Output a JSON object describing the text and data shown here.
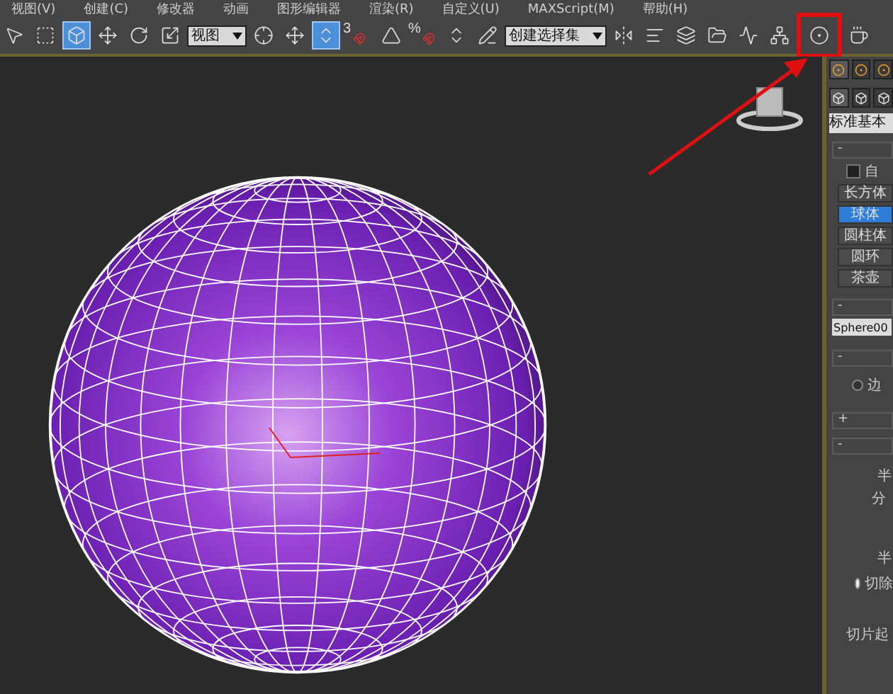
{
  "menu": [
    "视图(V)",
    "创建(C)",
    "修改器",
    "动画",
    "图形编辑器",
    "渲染(R)",
    "自定义(U)",
    "MAXScript(M)",
    "帮助(H)"
  ],
  "toolbar": [
    {
      "kind": "tool",
      "selected": false
    },
    {
      "kind": "tool",
      "selected": false
    },
    {
      "kind": "tool",
      "selected": true
    },
    {
      "kind": "tool",
      "selected": false
    },
    {
      "kind": "tool",
      "selected": false
    },
    {
      "kind": "tool",
      "selected": false
    },
    {
      "kind": "dropdown",
      "value": "视图"
    },
    {
      "kind": "tool",
      "selected": false
    },
    {
      "kind": "tool",
      "selected": false
    },
    {
      "kind": "tool",
      "selected": true
    },
    {
      "kind": "snap",
      "label": "3"
    },
    {
      "kind": "tool",
      "selected": false
    },
    {
      "kind": "snap",
      "label": "%"
    },
    {
      "kind": "tool",
      "selected": false
    },
    {
      "kind": "tool",
      "selected": false
    },
    {
      "kind": "dropdown",
      "value": "创建选择集"
    },
    {
      "kind": "tool",
      "selected": false
    },
    {
      "kind": "tool",
      "selected": false
    },
    {
      "kind": "tool",
      "selected": false
    },
    {
      "kind": "tool",
      "selected": false
    },
    {
      "kind": "tool",
      "selected": false
    },
    {
      "kind": "tool",
      "selected": false
    },
    {
      "kind": "tool",
      "selected": false,
      "highlighted": true
    },
    {
      "kind": "tool",
      "selected": false
    }
  ],
  "panel": {
    "tabs": [
      {
        "selected": true
      },
      {
        "selected": false
      },
      {
        "selected": false
      }
    ],
    "categories": [
      {
        "selected": true
      },
      {
        "selected": false
      },
      {
        "selected": false
      }
    ],
    "dropdown": "标准基本",
    "autogrid": {
      "label": "自",
      "checked": false
    },
    "object_types": [
      {
        "label": "长方体",
        "selected": false
      },
      {
        "label": "球体",
        "selected": true
      },
      {
        "label": "圆柱体",
        "selected": false
      },
      {
        "label": "圆环",
        "selected": false
      },
      {
        "label": "茶壶",
        "selected": false
      }
    ],
    "name_field": "Sphere00",
    "sections": [
      "-",
      "-",
      "-",
      "+",
      "-"
    ],
    "method_radio": {
      "label": "边",
      "selected": false
    },
    "params_labels": [
      "半",
      "分",
      "半"
    ],
    "hemi_radio": {
      "label": "切除",
      "selected": true
    },
    "slice_label": "切片起"
  }
}
